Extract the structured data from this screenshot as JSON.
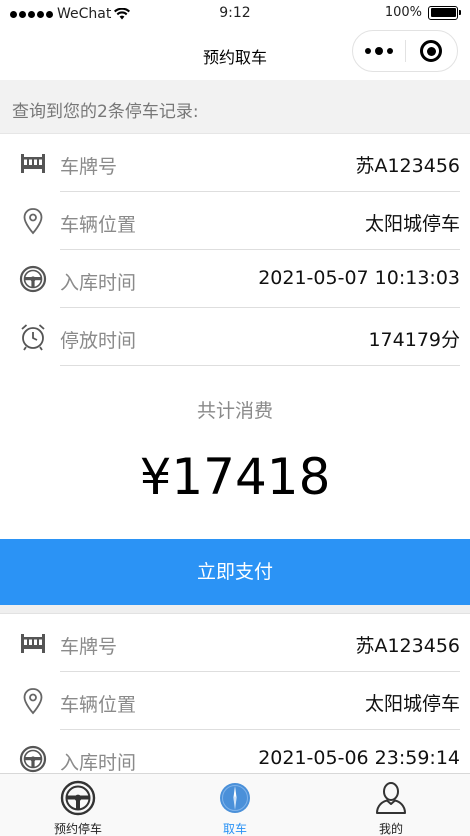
{
  "status_bar": {
    "carrier": "WeChat",
    "time": "9:12",
    "battery": "100%"
  },
  "navbar": {
    "title": "预约取车"
  },
  "summary": {
    "text": "查询到您的2条停车记录:"
  },
  "records": [
    {
      "plate_label": "车牌号",
      "plate_value": "苏A123456",
      "location_label": "车辆位置",
      "location_value": "太阳城停车",
      "entry_label": "入库时间",
      "entry_value": "2021-05-07 10:13:03",
      "duration_label": "停放时间",
      "duration_value": "174179分"
    },
    {
      "plate_label": "车牌号",
      "plate_value": "苏A123456",
      "location_label": "车辆位置",
      "location_value": "太阳城停车",
      "entry_label": "入库时间",
      "entry_value": "2021-05-06 23:59:14"
    }
  ],
  "total": {
    "label": "共计消费",
    "amount": "¥17418"
  },
  "pay_button": {
    "label": "立即支付",
    "color": "#2b93f5"
  },
  "tabbar": {
    "tabs": [
      {
        "label": "预约停车",
        "icon": "steering-wheel-icon",
        "active": false
      },
      {
        "label": "取车",
        "icon": "compass-icon",
        "active": true
      },
      {
        "label": "我的",
        "icon": "user-icon",
        "active": false
      }
    ]
  }
}
